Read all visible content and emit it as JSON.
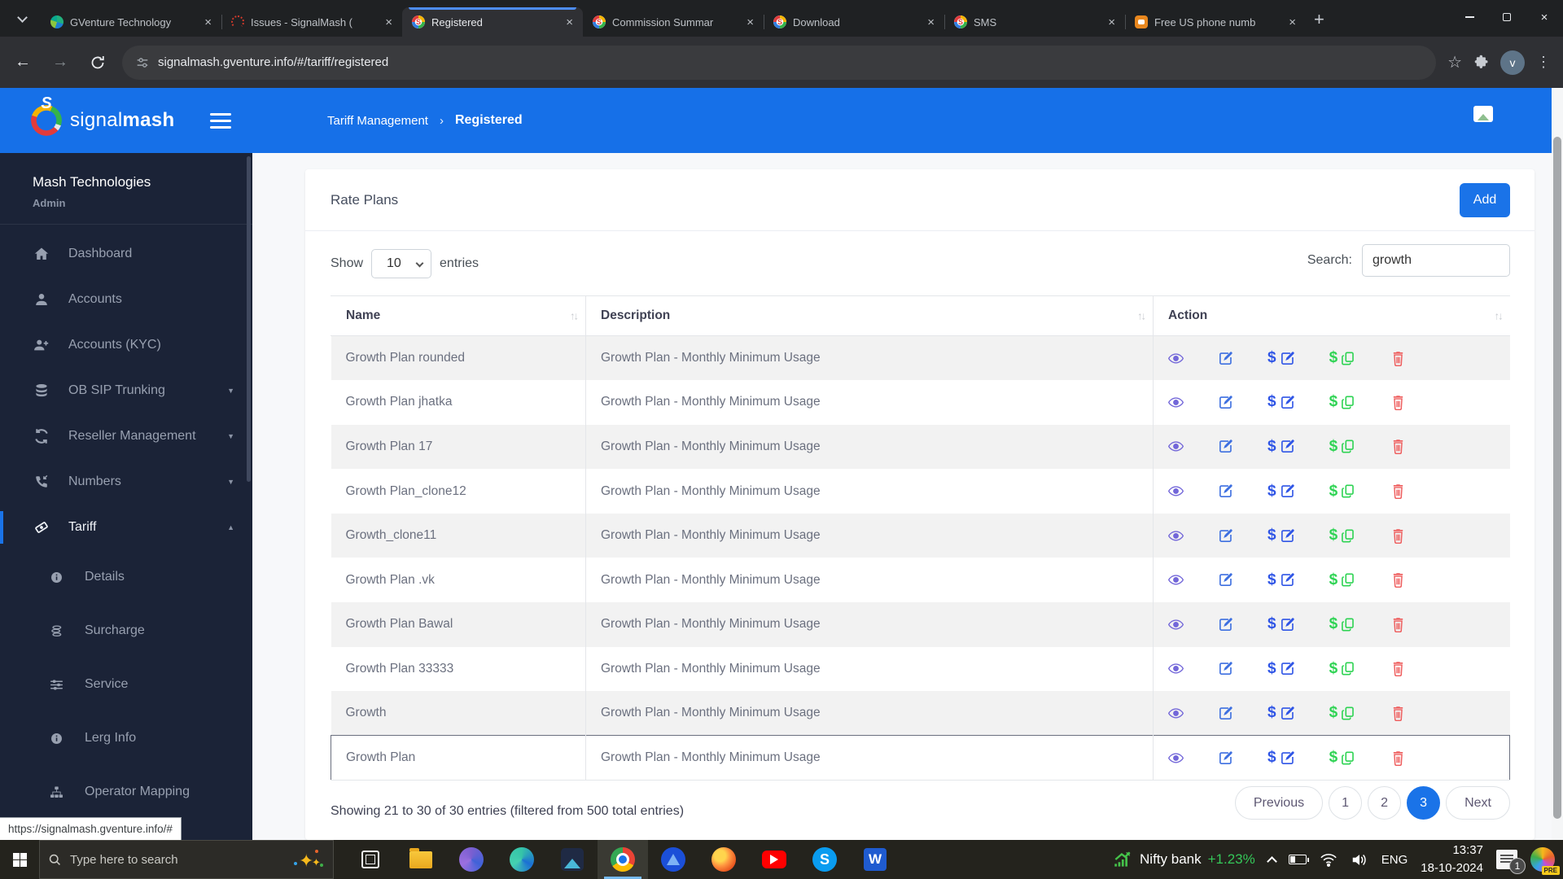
{
  "browser": {
    "tabs": [
      {
        "title": "GVenture Technology",
        "favicon": "gventure-icon",
        "active": false
      },
      {
        "title": "Issues - SignalMash (",
        "favicon": "issues-icon",
        "active": false
      },
      {
        "title": "Registered",
        "favicon": "signalmash-icon",
        "active": true
      },
      {
        "title": "Commission Summar",
        "favicon": "signalmash-icon",
        "active": false
      },
      {
        "title": "Download",
        "favicon": "signalmash-icon",
        "active": false
      },
      {
        "title": "SMS",
        "favicon": "signalmash-icon",
        "active": false
      },
      {
        "title": "Free US phone numb",
        "favicon": "phone-app-icon",
        "active": false
      }
    ],
    "new_tab_label": "+",
    "url": "signalmash.gventure.info/#/tariff/registered",
    "profile_initial": "v"
  },
  "header": {
    "brand_signal": "signal",
    "brand_mash": "mash",
    "breadcrumb_parent": "Tariff Management",
    "breadcrumb_sep": "›",
    "breadcrumb_current": "Registered"
  },
  "sidebar": {
    "org": "Mash Technologies",
    "role": "Admin",
    "items": [
      {
        "label": "Dashboard",
        "icon": "home-icon"
      },
      {
        "label": "Accounts",
        "icon": "user-icon"
      },
      {
        "label": "Accounts (KYC)",
        "icon": "user-plus-icon"
      },
      {
        "label": "OB SIP Trunking",
        "icon": "stack-icon",
        "caret": "down"
      },
      {
        "label": "Reseller Management",
        "icon": "sync-icon",
        "caret": "down"
      },
      {
        "label": "Numbers",
        "icon": "phone-icon",
        "caret": "down"
      },
      {
        "label": "Tariff",
        "icon": "ticket-icon",
        "caret": "up",
        "active": true
      },
      {
        "label": "Details",
        "icon": "info-icon",
        "sub": true
      },
      {
        "label": "Surcharge",
        "icon": "coins-icon",
        "sub": true
      },
      {
        "label": "Service",
        "icon": "sliders-icon",
        "sub": true
      },
      {
        "label": "Lerg Info",
        "icon": "info-icon",
        "sub": true
      },
      {
        "label": "Operator Mapping",
        "icon": "sitemap-icon",
        "sub": true
      }
    ]
  },
  "page": {
    "title": "Rate Plans",
    "add_label": "Add",
    "show_label": "Show",
    "page_size": "10",
    "entries_label": "entries",
    "search_label": "Search:",
    "search_value": "growth",
    "table": {
      "columns": [
        "Name",
        "Description",
        "Action"
      ],
      "rows": [
        {
          "name": "Growth Plan rounded",
          "description": "Growth Plan - Monthly Minimum Usage"
        },
        {
          "name": "Growth Plan jhatka",
          "description": "Growth Plan - Monthly Minimum Usage"
        },
        {
          "name": "Growth Plan 17",
          "description": "Growth Plan - Monthly Minimum Usage"
        },
        {
          "name": "Growth Plan_clone12",
          "description": "Growth Plan - Monthly Minimum Usage"
        },
        {
          "name": "Growth_clone11",
          "description": "Growth Plan - Monthly Minimum Usage"
        },
        {
          "name": "Growth Plan .vk",
          "description": "Growth Plan - Monthly Minimum Usage"
        },
        {
          "name": "Growth Plan Bawal",
          "description": "Growth Plan - Monthly Minimum Usage"
        },
        {
          "name": "Growth Plan 33333",
          "description": "Growth Plan - Monthly Minimum Usage"
        },
        {
          "name": "Growth",
          "description": "Growth Plan - Monthly Minimum Usage"
        },
        {
          "name": "Growth Plan",
          "description": "Growth Plan - Monthly Minimum Usage"
        }
      ]
    },
    "footer_text": "Showing 21 to 30 of 30 entries (filtered from 500 total entries)",
    "pagination": {
      "prev": "Previous",
      "pages": [
        "1",
        "2",
        "3"
      ],
      "active": "3",
      "next": "Next"
    },
    "status_link": "https://signalmash.gventure.info/#"
  },
  "taskbar": {
    "search_placeholder": "Type here to search",
    "ticker_label": "Nifty bank",
    "ticker_change": "+1.23%",
    "lang": "ENG",
    "time": "13:37",
    "date": "18-10-2024",
    "notification_count": "1",
    "copilot_badge": "PRE"
  },
  "colors": {
    "accent_blue": "#1a73e8",
    "header_blue": "#1670e8",
    "sidebar_navy": "#1b2337",
    "view_violet": "#7367d9",
    "edit_blue": "#3d6fe0",
    "copy_green": "#2ed353",
    "delete_red": "#ee5a5a",
    "ticker_green": "#35c759"
  }
}
